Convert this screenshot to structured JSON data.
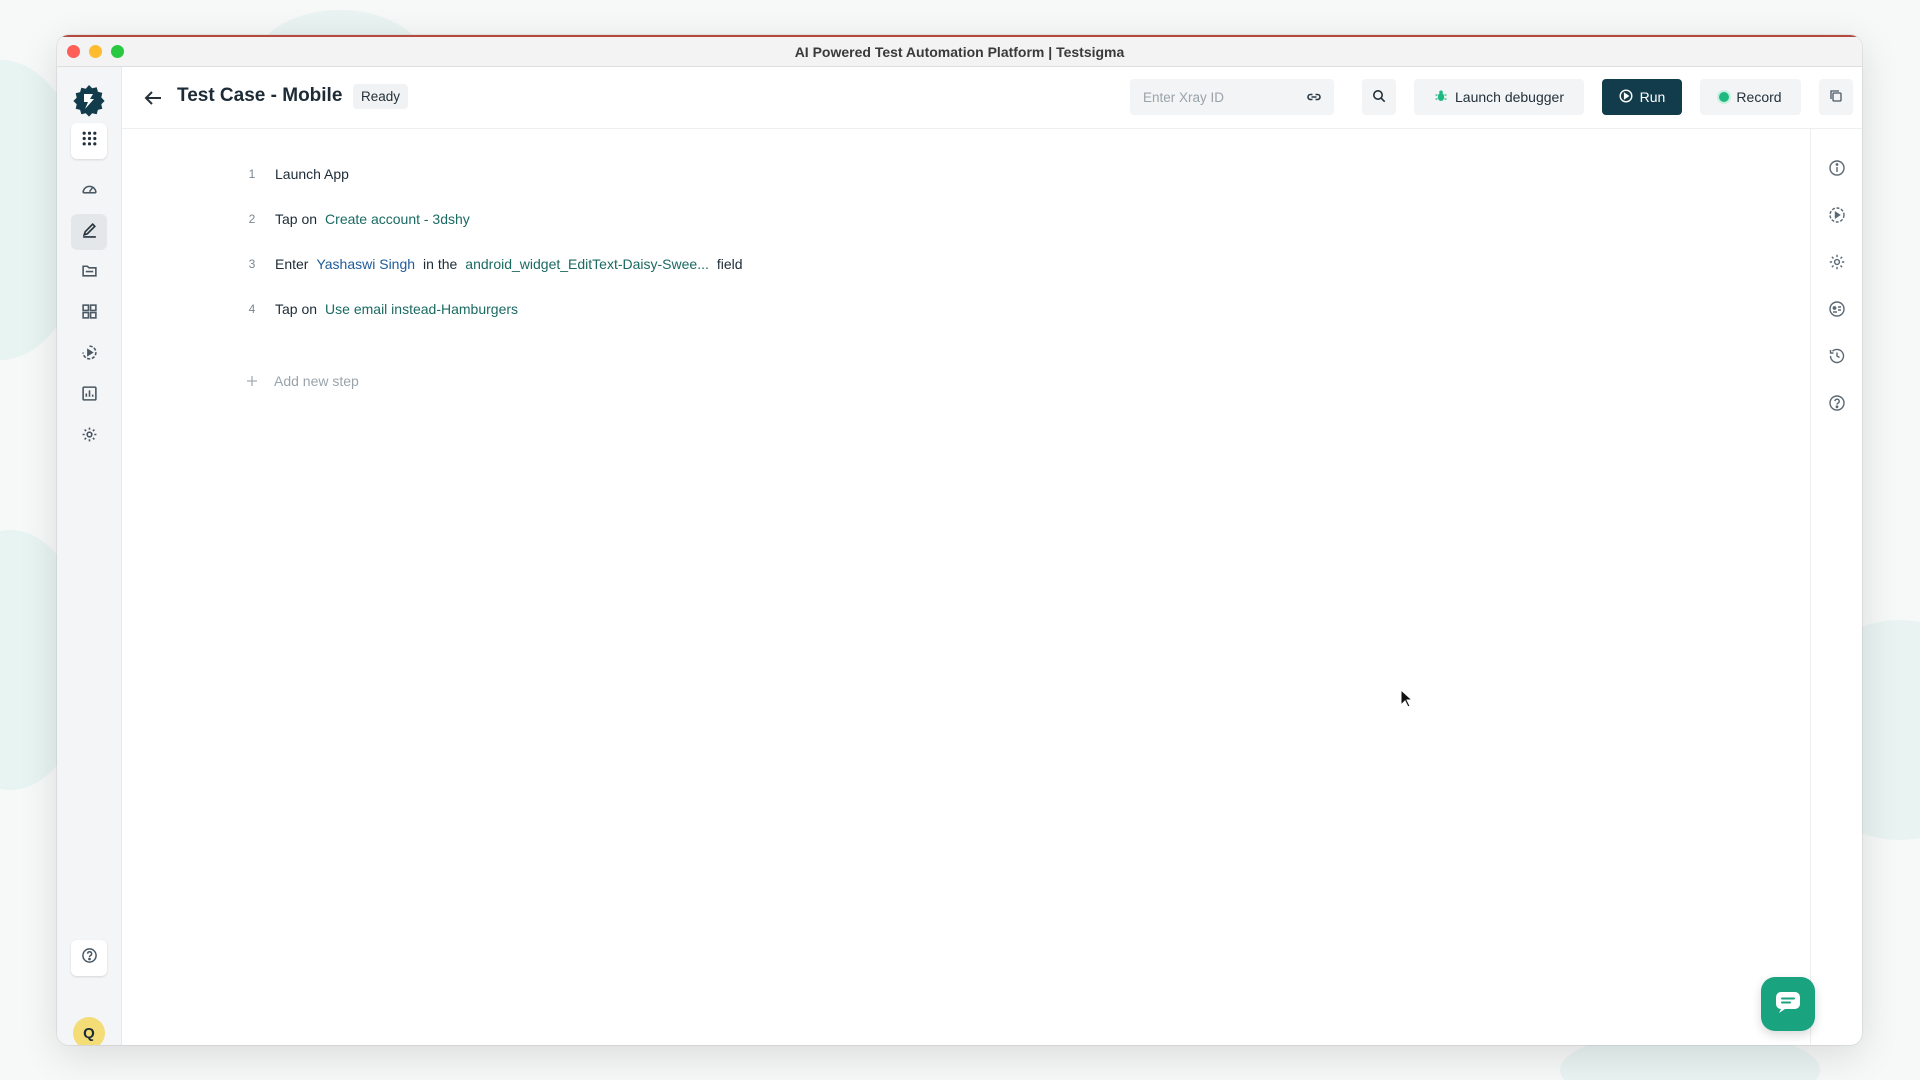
{
  "window": {
    "title": "AI Powered Test Automation Platform | Testsigma"
  },
  "header": {
    "title": "Test Case - Mobile",
    "status": "Ready",
    "xray_placeholder": "Enter Xray ID",
    "launch_debugger_label": "Launch debugger",
    "run_label": "Run",
    "record_label": "Record"
  },
  "sidebar": {
    "avatar_initial": "Q",
    "items": [
      {
        "icon": "grid-dots-icon"
      },
      {
        "icon": "dashboard-gauge-icon"
      },
      {
        "icon": "pencil-icon"
      },
      {
        "icon": "folder-icon"
      },
      {
        "icon": "apps-grid-icon"
      },
      {
        "icon": "play-circle-icon"
      },
      {
        "icon": "chart-icon"
      },
      {
        "icon": "gear-icon"
      },
      {
        "icon": "help-icon"
      }
    ]
  },
  "steps": [
    {
      "number": "1",
      "parts": [
        {
          "text": "Launch App",
          "type": "plain"
        }
      ]
    },
    {
      "number": "2",
      "parts": [
        {
          "text": "Tap on",
          "type": "plain"
        },
        {
          "text": "Create account - 3dshy",
          "type": "element"
        }
      ]
    },
    {
      "number": "3",
      "parts": [
        {
          "text": "Enter",
          "type": "plain"
        },
        {
          "text": "Yashaswi Singh",
          "type": "value"
        },
        {
          "text": "in the",
          "type": "plain"
        },
        {
          "text": "android_widget_EditText-Daisy-Swee...",
          "type": "element"
        },
        {
          "text": "field",
          "type": "plain"
        }
      ]
    },
    {
      "number": "4",
      "parts": [
        {
          "text": "Tap on",
          "type": "plain"
        },
        {
          "text": "Use email instead-Hamburgers",
          "type": "element"
        }
      ]
    }
  ],
  "add_step_label": "Add new step",
  "right_rail": [
    "info-icon",
    "play-settings-icon",
    "gear-icon",
    "smart-id-icon",
    "history-icon",
    "help-icon"
  ],
  "colors": {
    "primary": "#123c4c",
    "accent": "#1aa37f",
    "element_link": "#1a6a62",
    "value_link": "#1d5c99"
  }
}
